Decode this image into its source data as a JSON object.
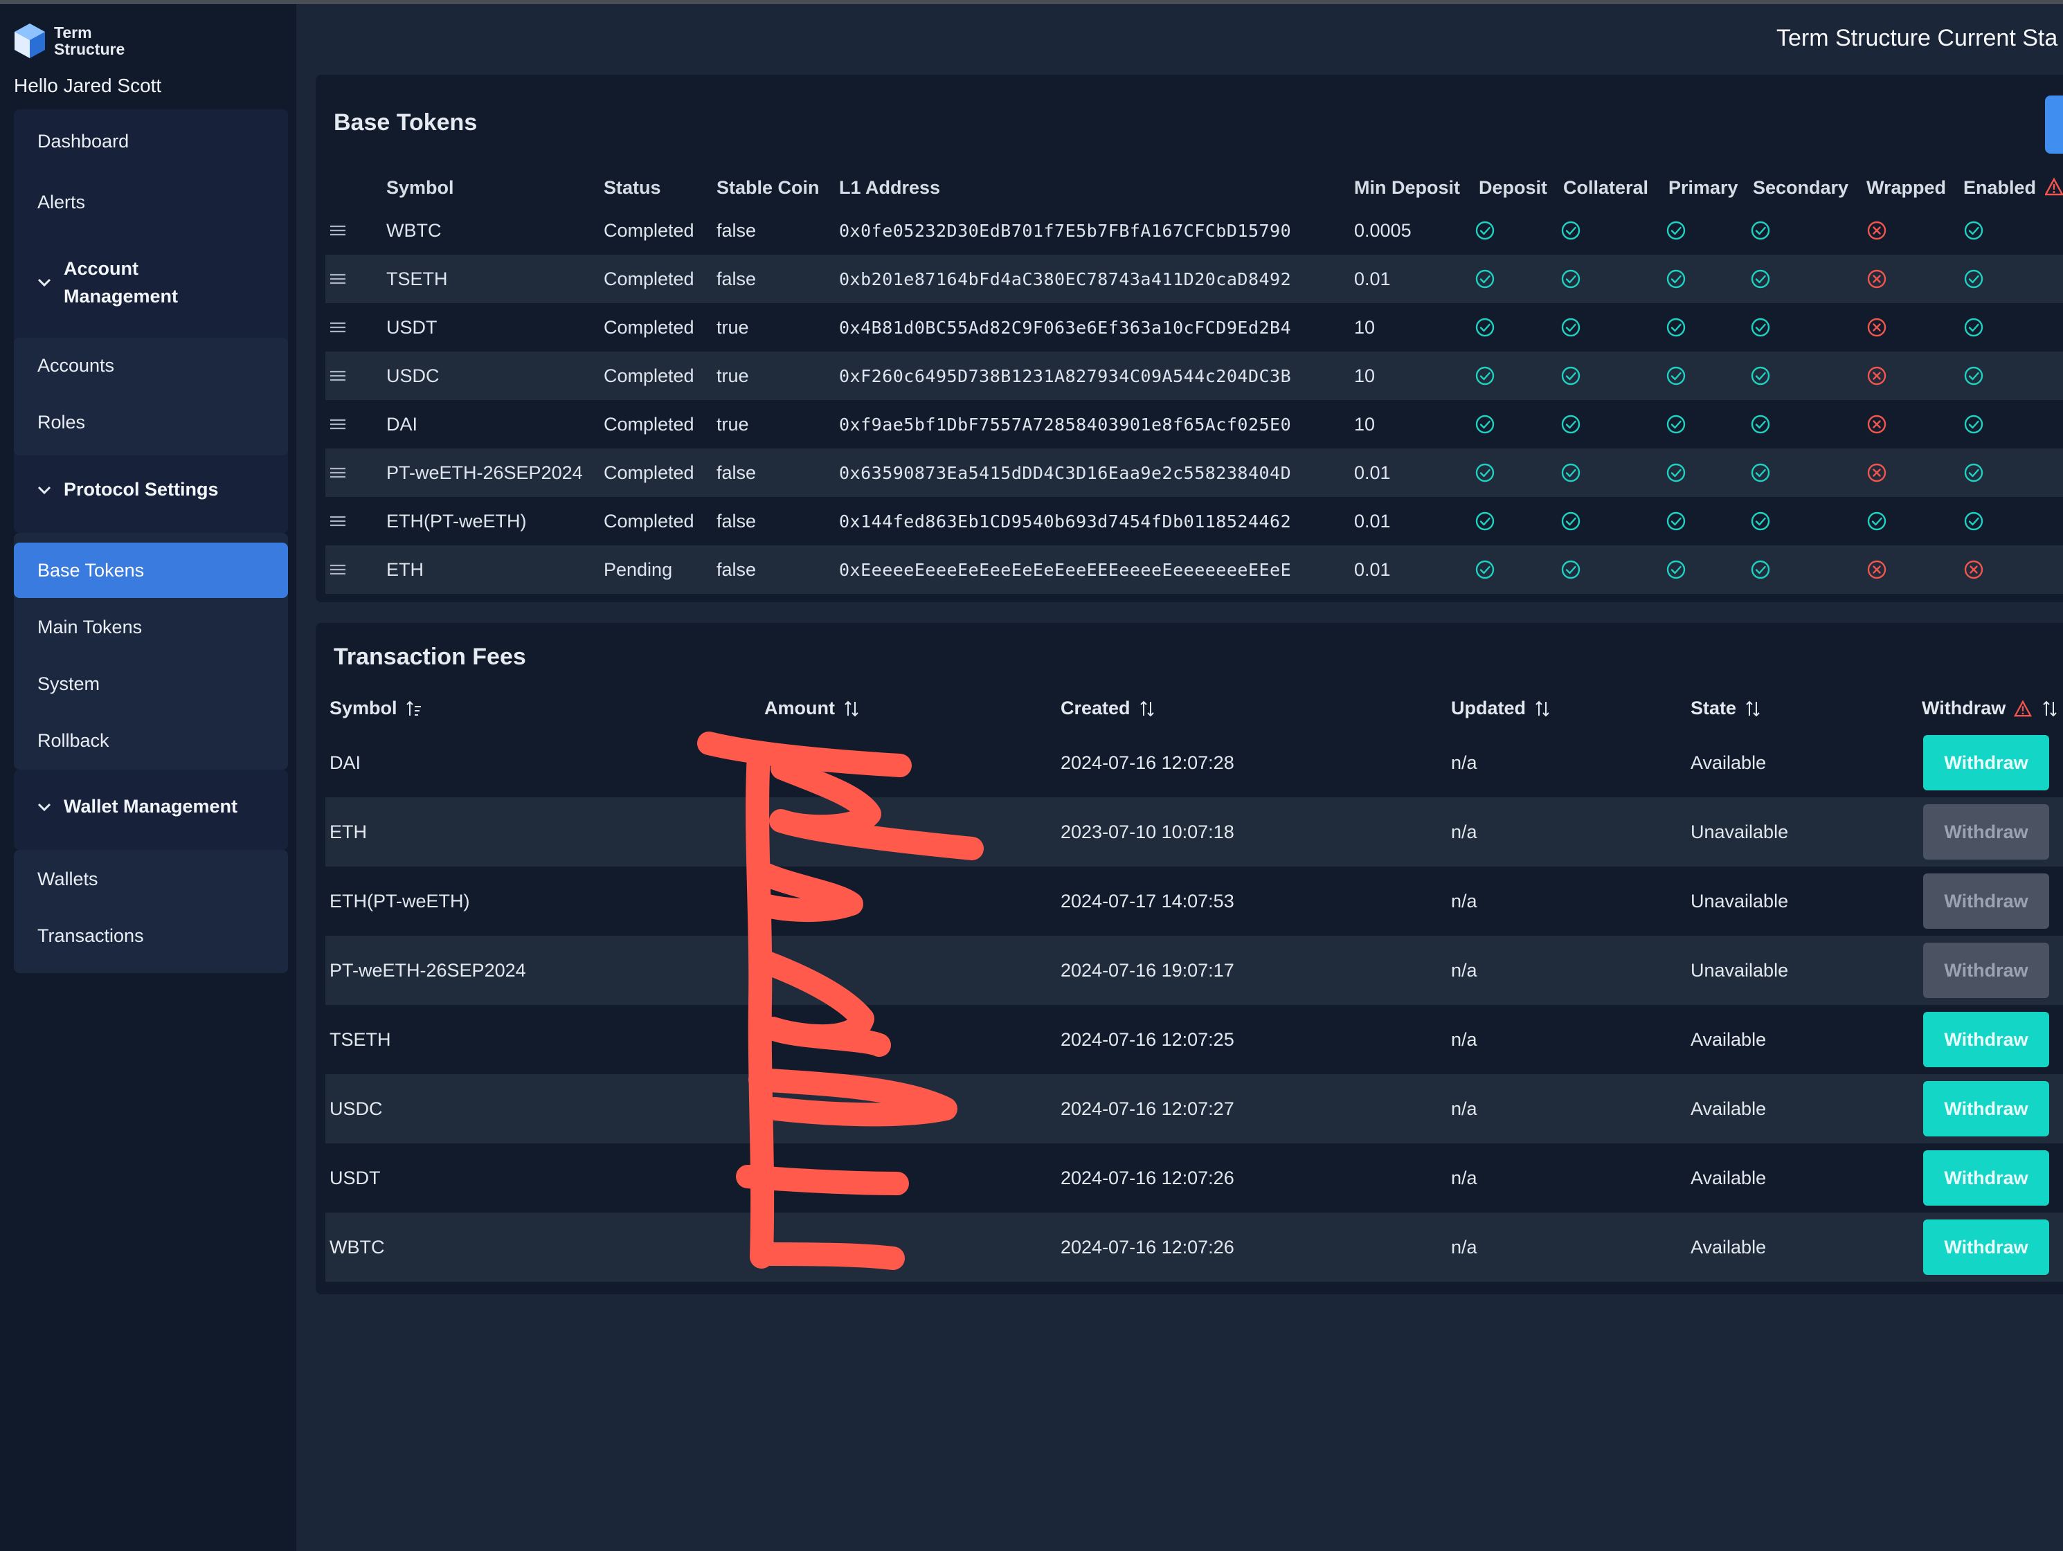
{
  "brand": {
    "name_line1": "Term",
    "name_line2": "Structure",
    "greeting": "Hello Jared Scott"
  },
  "page": {
    "title": "Term Structure Current Sta"
  },
  "sidebar": {
    "top_items": [
      {
        "label": "Dashboard"
      },
      {
        "label": "Alerts"
      }
    ],
    "account_section": {
      "label_line1": "Account",
      "label_line2": "Management"
    },
    "account_items": [
      {
        "label": "Accounts"
      },
      {
        "label": "Roles"
      }
    ],
    "protocol_section": {
      "label": "Protocol Settings"
    },
    "protocol_items": [
      {
        "label": "Base Tokens",
        "active": true
      },
      {
        "label": "Main Tokens"
      },
      {
        "label": "System"
      },
      {
        "label": "Rollback"
      }
    ],
    "wallet_section": {
      "label": "Wallet Management"
    },
    "wallet_items": [
      {
        "label": "Wallets"
      },
      {
        "label": "Transactions"
      }
    ]
  },
  "base_tokens": {
    "title": "Base Tokens",
    "headers": {
      "symbol": "Symbol",
      "status": "Status",
      "stable": "Stable Coin",
      "l1": "L1 Address",
      "min_deposit": "Min Deposit",
      "deposit": "Deposit",
      "collateral": "Collateral",
      "primary": "Primary",
      "secondary": "Secondary",
      "wrapped": "Wrapped",
      "enabled": "Enabled"
    },
    "rows": [
      {
        "symbol": "WBTC",
        "status": "Completed",
        "stable": "false",
        "l1": "0x0fe05232D30EdB701f7E5b7FBfA167CFCbD15790",
        "min_deposit": "0.0005",
        "flags": [
          1,
          1,
          1,
          1,
          0,
          1
        ]
      },
      {
        "symbol": "TSETH",
        "status": "Completed",
        "stable": "false",
        "l1": "0xb201e87164bFd4aC380EC78743a411D20caD8492",
        "min_deposit": "0.01",
        "flags": [
          1,
          1,
          1,
          1,
          0,
          1
        ]
      },
      {
        "symbol": "USDT",
        "status": "Completed",
        "stable": "true",
        "l1": "0x4B81d0BC55Ad82C9F063e6Ef363a10cFCD9Ed2B4",
        "min_deposit": "10",
        "flags": [
          1,
          1,
          1,
          1,
          0,
          1
        ]
      },
      {
        "symbol": "USDC",
        "status": "Completed",
        "stable": "true",
        "l1": "0xF260c6495D738B1231A827934C09A544c204DC3B",
        "min_deposit": "10",
        "flags": [
          1,
          1,
          1,
          1,
          0,
          1
        ]
      },
      {
        "symbol": "DAI",
        "status": "Completed",
        "stable": "true",
        "l1": "0xf9ae5bf1DbF7557A72858403901e8f65Acf025E0",
        "min_deposit": "10",
        "flags": [
          1,
          1,
          1,
          1,
          0,
          1
        ]
      },
      {
        "symbol": "PT-weETH-26SEP2024",
        "status": "Completed",
        "stable": "false",
        "l1": "0x63590873Ea5415dDD4C3D16Eaa9e2c558238404D",
        "min_deposit": "0.01",
        "flags": [
          1,
          1,
          1,
          1,
          0,
          1
        ]
      },
      {
        "symbol": "ETH(PT-weETH)",
        "status": "Completed",
        "stable": "false",
        "l1": "0x144fed863Eb1CD9540b693d7454fDb0118524462",
        "min_deposit": "0.01",
        "flags": [
          1,
          1,
          1,
          1,
          1,
          1
        ]
      },
      {
        "symbol": "ETH",
        "status": "Pending",
        "stable": "false",
        "l1": "0xEeeeeEeeeEeEeeEeEeEeeEEEeeeeEeeeeeeeEEeE",
        "min_deposit": "0.01",
        "flags": [
          1,
          1,
          1,
          1,
          0,
          0
        ]
      }
    ]
  },
  "tx_fees": {
    "title": "Transaction Fees",
    "headers": {
      "symbol": "Symbol",
      "amount": "Amount",
      "created": "Created",
      "updated": "Updated",
      "state": "State",
      "withdraw": "Withdraw"
    },
    "rows": [
      {
        "symbol": "DAI",
        "created": "2024-07-16 12:07:28",
        "updated": "n/a",
        "state": "Available",
        "withdraw_label": "Withdraw",
        "enabled": true
      },
      {
        "symbol": "ETH",
        "created": "2023-07-10 10:07:18",
        "updated": "n/a",
        "state": "Unavailable",
        "withdraw_label": "Withdraw",
        "enabled": false
      },
      {
        "symbol": "ETH(PT-weETH)",
        "created": "2024-07-17 14:07:53",
        "updated": "n/a",
        "state": "Unavailable",
        "withdraw_label": "Withdraw",
        "enabled": false
      },
      {
        "symbol": "PT-weETH-26SEP2024",
        "created": "2024-07-16 19:07:17",
        "updated": "n/a",
        "state": "Unavailable",
        "withdraw_label": "Withdraw",
        "enabled": false
      },
      {
        "symbol": "TSETH",
        "created": "2024-07-16 12:07:25",
        "updated": "n/a",
        "state": "Available",
        "withdraw_label": "Withdraw",
        "enabled": true
      },
      {
        "symbol": "USDC",
        "created": "2024-07-16 12:07:27",
        "updated": "n/a",
        "state": "Available",
        "withdraw_label": "Withdraw",
        "enabled": true
      },
      {
        "symbol": "USDT",
        "created": "2024-07-16 12:07:26",
        "updated": "n/a",
        "state": "Available",
        "withdraw_label": "Withdraw",
        "enabled": true
      },
      {
        "symbol": "WBTC",
        "created": "2024-07-16 12:07:26",
        "updated": "n/a",
        "state": "Available",
        "withdraw_label": "Withdraw",
        "enabled": true
      }
    ]
  },
  "colors": {
    "accent": "#3a7bdf",
    "teal": "#14d6c6",
    "ok": "#1fd1c1",
    "error": "#f2554d",
    "redaction": "#ff5a4c"
  },
  "icons": {
    "ok": "check-circle-icon",
    "no": "x-circle-icon",
    "drag": "drag-handle-icon",
    "sort": "sort-arrows-icon",
    "warn": "warning-triangle-icon"
  }
}
